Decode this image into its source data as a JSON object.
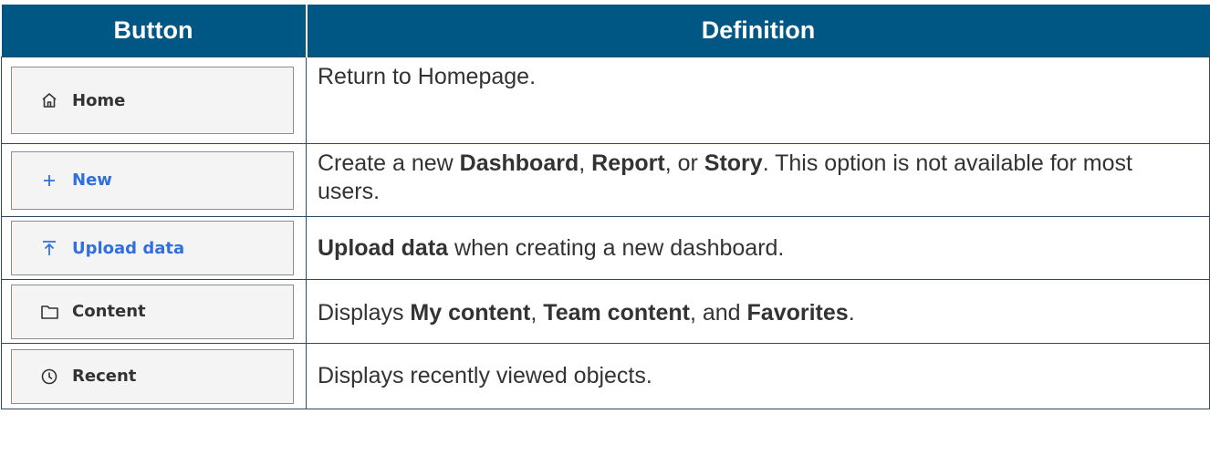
{
  "header": {
    "button_col": "Button",
    "definition_col": "Definition"
  },
  "rows": [
    {
      "button_label": "Home",
      "icon": "home-icon",
      "definition": [
        {
          "text": "Return to Homepage.",
          "bold": false
        }
      ]
    },
    {
      "button_label": "New",
      "icon": "plus-icon",
      "definition": [
        {
          "text": "Create a new ",
          "bold": false
        },
        {
          "text": "Dashboard",
          "bold": true
        },
        {
          "text": ", ",
          "bold": false
        },
        {
          "text": "Report",
          "bold": true
        },
        {
          "text": ", or ",
          "bold": false
        },
        {
          "text": "Story",
          "bold": true
        },
        {
          "text": ". This option is not available for most users.",
          "bold": false
        }
      ]
    },
    {
      "button_label": "Upload data",
      "icon": "upload-icon",
      "definition": [
        {
          "text": "Upload data",
          "bold": true
        },
        {
          "text": " when creating a new dashboard.",
          "bold": false
        }
      ]
    },
    {
      "button_label": "Content",
      "icon": "folder-icon",
      "definition": [
        {
          "text": "Displays ",
          "bold": false
        },
        {
          "text": "My content",
          "bold": true
        },
        {
          "text": ", ",
          "bold": false
        },
        {
          "text": "Team content",
          "bold": true
        },
        {
          "text": ", and ",
          "bold": false
        },
        {
          "text": "Favorites",
          "bold": true
        },
        {
          "text": ".",
          "bold": false
        }
      ]
    },
    {
      "button_label": "Recent",
      "icon": "clock-icon",
      "definition": [
        {
          "text": "Displays recently viewed objects.",
          "bold": false
        }
      ]
    }
  ],
  "colors": {
    "header_bg": "#005783",
    "accent_blue": "#2f6fe0",
    "button_bg": "#f4f4f4"
  }
}
